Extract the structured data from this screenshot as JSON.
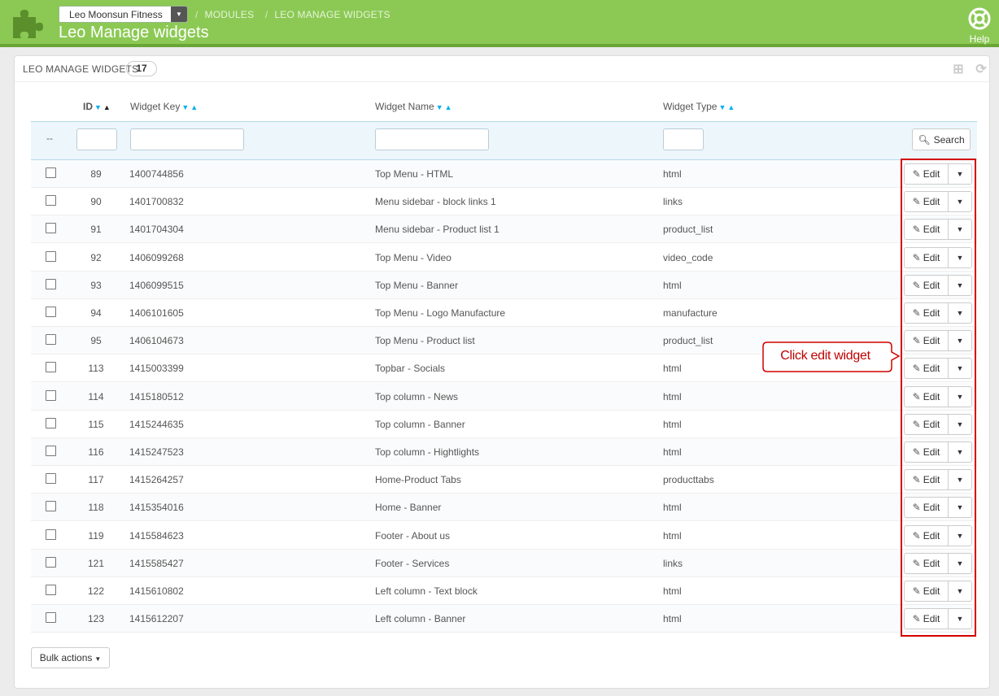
{
  "header": {
    "store_name": "Leo Moonsun Fitness",
    "breadcrumbs": [
      "MODULES",
      "LEO MANAGE WIDGETS"
    ],
    "page_title": "Leo Manage widgets",
    "help_label": "Help",
    "brand_color": "#8bc954"
  },
  "panel": {
    "title": "LEO MANAGE WIDGETS",
    "count": "17"
  },
  "table": {
    "columns": {
      "id": "ID",
      "key": "Widget Key",
      "name": "Widget Name",
      "type": "Widget Type"
    },
    "filter_dash": "--",
    "search_label": "Search",
    "edit_label": "Edit",
    "rows": [
      {
        "id": "89",
        "key": "1400744856",
        "name": "Top Menu - HTML",
        "type": "html"
      },
      {
        "id": "90",
        "key": "1401700832",
        "name": "Menu sidebar - block links 1",
        "type": "links"
      },
      {
        "id": "91",
        "key": "1401704304",
        "name": "Menu sidebar - Product list 1",
        "type": "product_list"
      },
      {
        "id": "92",
        "key": "1406099268",
        "name": "Top Menu - Video",
        "type": "video_code"
      },
      {
        "id": "93",
        "key": "1406099515",
        "name": "Top Menu - Banner",
        "type": "html"
      },
      {
        "id": "94",
        "key": "1406101605",
        "name": "Top Menu - Logo Manufacture",
        "type": "manufacture"
      },
      {
        "id": "95",
        "key": "1406104673",
        "name": "Top Menu - Product list",
        "type": "product_list"
      },
      {
        "id": "113",
        "key": "1415003399",
        "name": "Topbar - Socials",
        "type": "html"
      },
      {
        "id": "114",
        "key": "1415180512",
        "name": "Top column - News",
        "type": "html"
      },
      {
        "id": "115",
        "key": "1415244635",
        "name": "Top column - Banner",
        "type": "html"
      },
      {
        "id": "116",
        "key": "1415247523",
        "name": "Top column - Hightlights",
        "type": "html"
      },
      {
        "id": "117",
        "key": "1415264257",
        "name": "Home-Product Tabs",
        "type": "producttabs"
      },
      {
        "id": "118",
        "key": "1415354016",
        "name": "Home - Banner",
        "type": "html"
      },
      {
        "id": "119",
        "key": "1415584623",
        "name": "Footer - About us",
        "type": "html"
      },
      {
        "id": "121",
        "key": "1415585427",
        "name": "Footer - Services",
        "type": "links"
      },
      {
        "id": "122",
        "key": "1415610802",
        "name": "Left column - Text block",
        "type": "html"
      },
      {
        "id": "123",
        "key": "1415612207",
        "name": "Left column - Banner",
        "type": "html"
      }
    ]
  },
  "bulk_actions_label": "Bulk actions",
  "annotation": {
    "callout_text": "Click edit widget",
    "highlight_color": "#d40000"
  }
}
